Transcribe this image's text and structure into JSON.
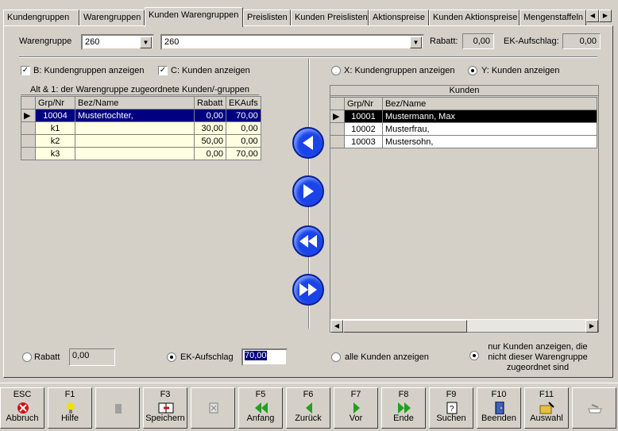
{
  "tabs": [
    {
      "label": "Kundengruppen"
    },
    {
      "label": "Warengruppen"
    },
    {
      "label": "Kunden Warengruppen"
    },
    {
      "label": "Preislisten"
    },
    {
      "label": "Kunden Preislisten"
    },
    {
      "label": "Aktionspreise"
    },
    {
      "label": "Kunden Aktionspreise"
    },
    {
      "label": "Mengenstaffeln"
    }
  ],
  "header": {
    "warengruppe_label": "Warengruppe",
    "warengruppe_value": "260",
    "warengruppe_name": "260",
    "rabatt_label": "Rabatt:",
    "rabatt_value": "0,00",
    "ek_label": "EK-Aufschlag:",
    "ek_value": "0,00"
  },
  "left": {
    "chk_b_label": "B: Kundengruppen anzeigen",
    "chk_c_label": "C: Kunden anzeigen",
    "grid_title": "Alt & 1: der Warengruppe zugeordnete Kunden/-gruppen",
    "columns": [
      "Grp/Nr",
      "Bez/Name",
      "Rabatt",
      "EKAufs"
    ],
    "rows": [
      {
        "nr": "10004",
        "name": "Mustertochter,",
        "rabatt": "0,00",
        "ek": "70,00"
      },
      {
        "nr": "k1",
        "name": "",
        "rabatt": "30,00",
        "ek": "0,00"
      },
      {
        "nr": "k2",
        "name": "",
        "rabatt": "50,00",
        "ek": "0,00"
      },
      {
        "nr": "k3",
        "name": "",
        "rabatt": "0,00",
        "ek": "70,00"
      }
    ],
    "rabatt_radio_label": "Rabatt",
    "rabatt_value": "0,00",
    "ek_radio_label": "EK-Aufschlag",
    "ek_value": "70,00"
  },
  "right": {
    "radio_x_label": "X: Kundengruppen anzeigen",
    "radio_y_label": "Y: Kunden anzeigen",
    "grid_title": "Kunden",
    "columns": [
      "Grp/Nr",
      "Bez/Name"
    ],
    "rows": [
      {
        "nr": "10001",
        "name": "Mustermann, Max"
      },
      {
        "nr": "10002",
        "name": "Musterfrau,"
      },
      {
        "nr": "10003",
        "name": "Mustersohn,"
      }
    ],
    "alle_label": "alle Kunden anzeigen",
    "nur_label": "nur Kunden anzeigen, die nicht dieser Warengruppe zugeordnet sind"
  },
  "fkeys": [
    {
      "key": "ESC",
      "label": "Abbruch"
    },
    {
      "key": "F1",
      "label": "Hilfe"
    },
    {
      "key": "",
      "label": ""
    },
    {
      "key": "F3",
      "label": "Speichern"
    },
    {
      "key": "",
      "label": ""
    },
    {
      "key": "F5",
      "label": "Anfang"
    },
    {
      "key": "F6",
      "label": "Zurück"
    },
    {
      "key": "F7",
      "label": "Vor"
    },
    {
      "key": "F8",
      "label": "Ende"
    },
    {
      "key": "F9",
      "label": "Suchen"
    },
    {
      "key": "F10",
      "label": "Beenden"
    },
    {
      "key": "F11",
      "label": "Auswahl"
    },
    {
      "key": "",
      "label": ""
    }
  ],
  "colors": {
    "selection": "#000080",
    "grid_row": "#ffffe1",
    "arrow_blue": "#1a44e8"
  }
}
